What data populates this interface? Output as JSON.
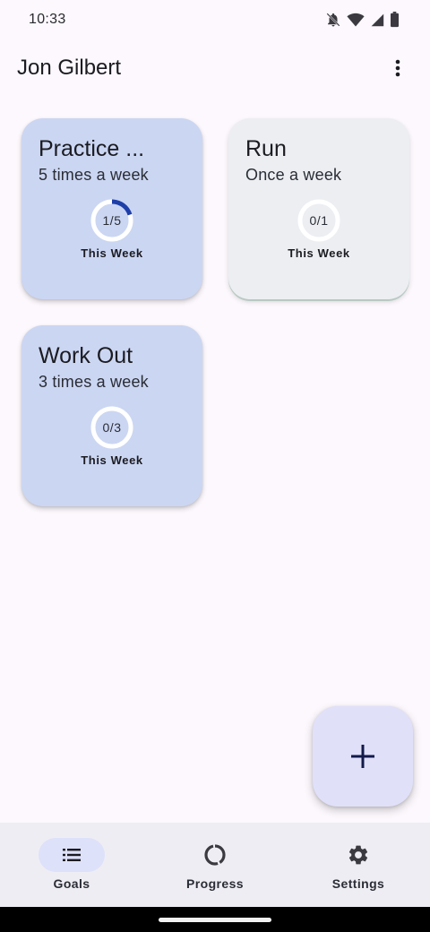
{
  "status_bar": {
    "time": "10:33",
    "icons": [
      "bell-off-icon",
      "wifi-icon",
      "signal-icon",
      "battery-icon"
    ]
  },
  "app_bar": {
    "title": "Jon Gilbert",
    "more_icon": "more-vert-icon"
  },
  "goals": [
    {
      "title": "Practice ...",
      "frequency": "5 times a week",
      "progress_text": "1/5",
      "completed": 1,
      "target": 5,
      "period_label": "This Week",
      "color": "#cbd6f2"
    },
    {
      "title": "Run",
      "frequency": "Once a week",
      "progress_text": "0/1",
      "completed": 0,
      "target": 1,
      "period_label": "This Week",
      "color": "#eceef2"
    },
    {
      "title": "Work Out",
      "frequency": "3 times a week",
      "progress_text": "0/3",
      "completed": 0,
      "target": 3,
      "period_label": "This Week",
      "color": "#cbd6f2"
    }
  ],
  "fab": {
    "icon": "add-icon"
  },
  "bottom_nav": {
    "items": [
      {
        "label": "Goals",
        "icon": "list-icon",
        "active": true
      },
      {
        "label": "Progress",
        "icon": "progress-ring-icon",
        "active": false
      },
      {
        "label": "Settings",
        "icon": "gear-icon",
        "active": false
      }
    ]
  },
  "colors": {
    "accent": "#1f3fa8",
    "background": "#fcf8fd",
    "nav_background": "#efedf4",
    "nav_active_pill": "#dde1f9",
    "fab_background": "#e0e0f9"
  }
}
